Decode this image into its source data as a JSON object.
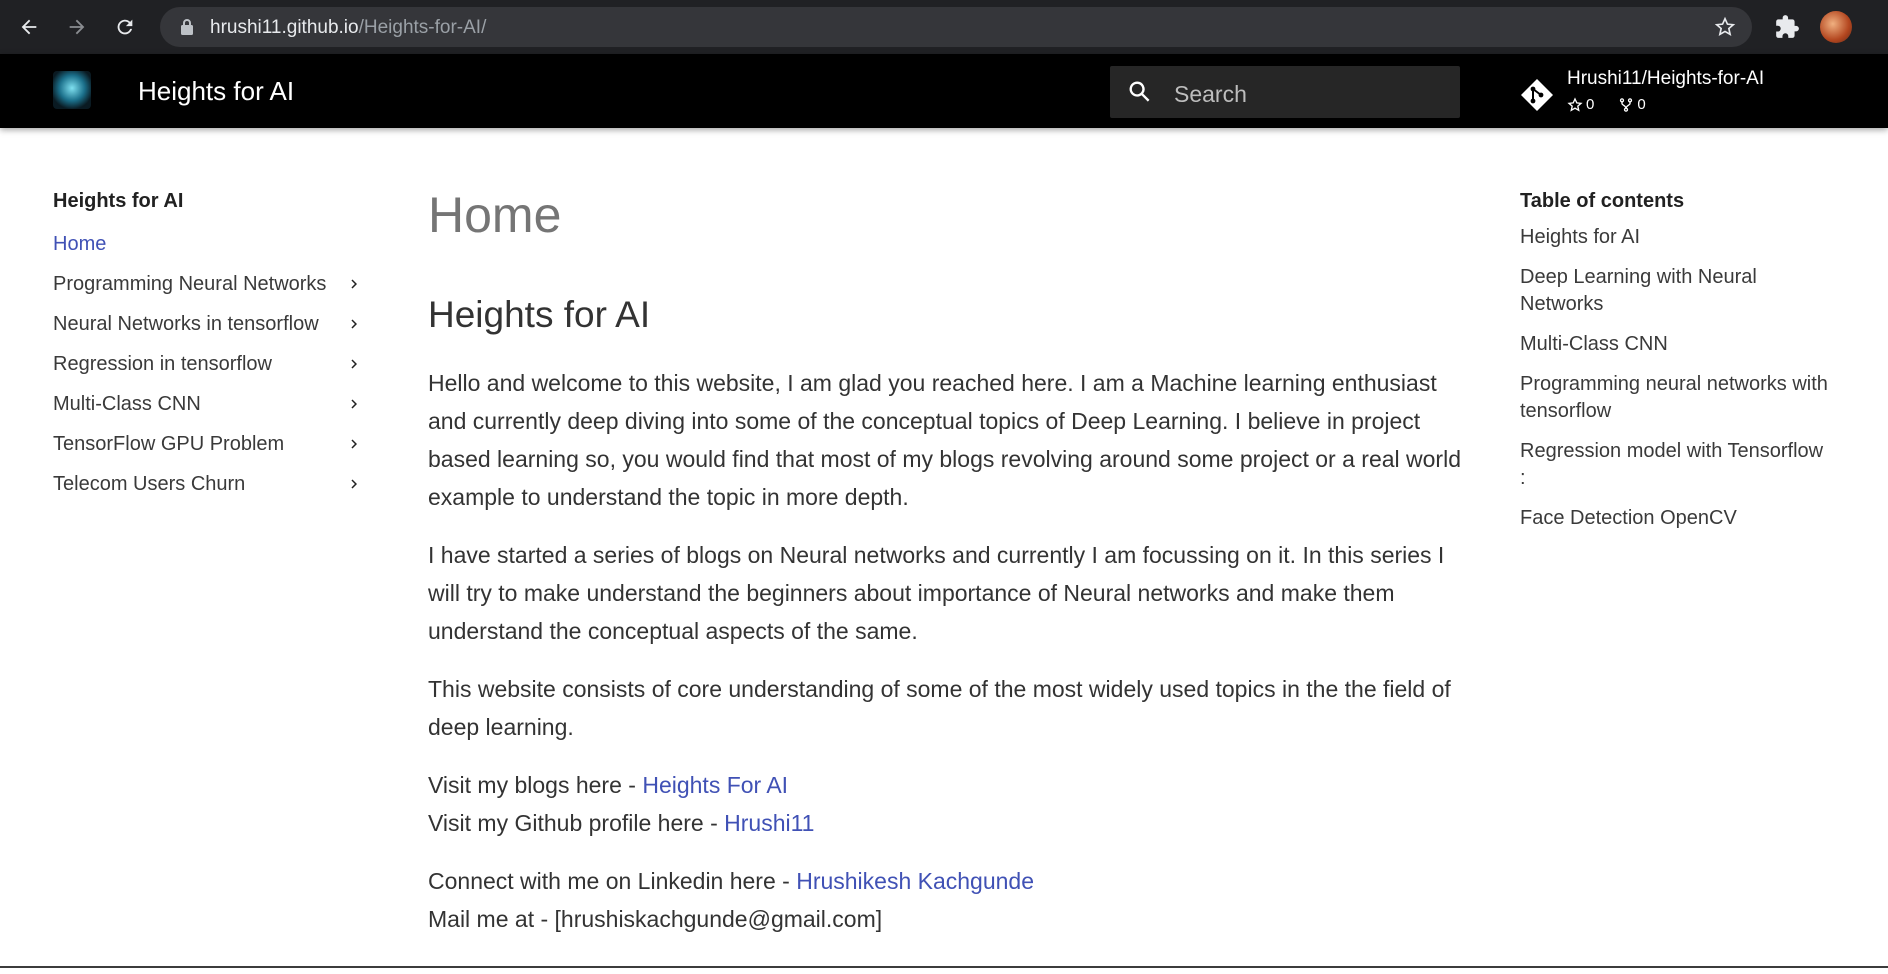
{
  "browser": {
    "url_host": "hrushi11.github.io",
    "url_path": "/Heights-for-AI/"
  },
  "header": {
    "site_title": "Heights for AI",
    "search_placeholder": "Search",
    "repo_name": "Hrushi11/Heights-for-AI",
    "stars": "0",
    "forks": "0"
  },
  "left_nav": {
    "title": "Heights for AI",
    "items": [
      {
        "label": "Home",
        "active": true
      },
      {
        "label": "Programming Neural Networks"
      },
      {
        "label": "Neural Networks in tensorflow"
      },
      {
        "label": "Regression in tensorflow"
      },
      {
        "label": "Multi-Class CNN"
      },
      {
        "label": "TensorFlow GPU Problem"
      },
      {
        "label": "Telecom Users Churn"
      }
    ]
  },
  "content": {
    "page_title": "Home",
    "heading": "Heights for AI",
    "p1": "Hello and welcome to this website, I am glad you reached here. I am a Machine learning enthusiast and currently deep diving into some of the conceptual topics of Deep Learning. I believe in project based learning so, you would find that most of my blogs revolving around some project or a real world example to understand the topic in more depth.",
    "p2": "I have started a series of blogs on Neural networks and currently I am focussing on it. In this series I will try to make understand the beginners about importance of Neural networks and make them understand the conceptual aspects of the same.",
    "p3": "This website consists of core understanding of some of the most widely used topics in the the field of deep learning.",
    "blogs_prefix": "Visit my blogs here - ",
    "blogs_link": "Heights For AI",
    "github_prefix": "Visit my Github profile here - ",
    "github_link": "Hrushi11",
    "linkedin_prefix": "Connect with me on Linkedin here - ",
    "linkedin_link": "Hrushikesh Kachgunde",
    "mail_text": "Mail me at - [hrushiskachgunde@gmail.com]"
  },
  "toc": {
    "title": "Table of contents",
    "items": [
      "Heights for AI",
      "Deep Learning with Neural Networks",
      "Multi-Class CNN",
      "Programming neural networks with tensorflow",
      "Regression model with Tensorflow :",
      "Face Detection OpenCV"
    ]
  }
}
